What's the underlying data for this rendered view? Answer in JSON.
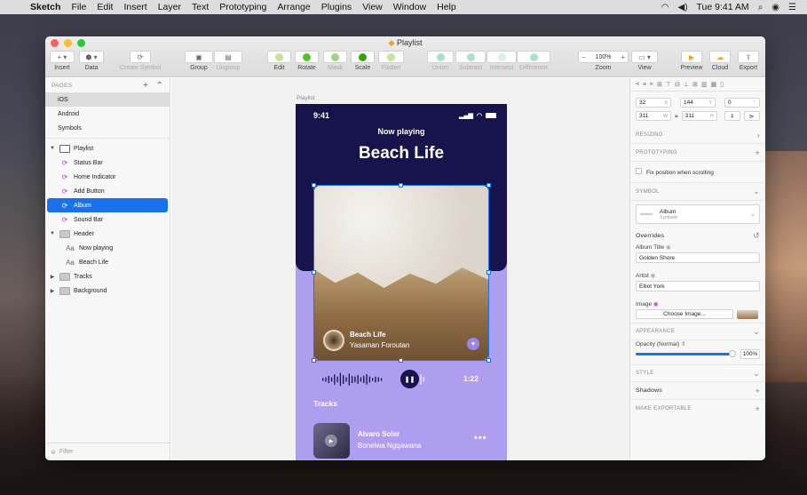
{
  "menubar": {
    "app": "Sketch",
    "items": [
      "File",
      "Edit",
      "Insert",
      "Layer",
      "Text",
      "Prototyping",
      "Arrange",
      "Plugins",
      "View",
      "Window",
      "Help"
    ],
    "clock": "Tue 9:41 AM"
  },
  "window": {
    "title": "Playlist"
  },
  "toolbar": {
    "insert": "Insert",
    "data": "Data",
    "create_symbol": "Create Symbol",
    "group": "Group",
    "ungroup": "Ungroup",
    "edit": "Edit",
    "rotate": "Rotate",
    "mask": "Mask",
    "scale": "Scale",
    "flatten": "Flatten",
    "union": "Union",
    "subtract": "Subtract",
    "intersect": "Intersect",
    "difference": "Difference",
    "zoom_label": "Zoom",
    "zoom_value": "100%",
    "view": "View",
    "preview": "Preview",
    "cloud": "Cloud",
    "export": "Export"
  },
  "layers": {
    "pages_header": "PAGES",
    "pages": [
      "iOS",
      "Android",
      "Symbols"
    ],
    "artboard": "Playlist",
    "items": [
      {
        "name": "Status Bar"
      },
      {
        "name": "Home Indicator"
      },
      {
        "name": "Add Button"
      },
      {
        "name": "Album"
      },
      {
        "name": "Sound Bar"
      }
    ],
    "header_group": "Header",
    "header_children": [
      "Now playing",
      "Beach Life"
    ],
    "tracks": "Tracks",
    "background": "Background",
    "filter_placeholder": "Filter"
  },
  "canvas": {
    "artboard_label": "Playlist",
    "time": "9:41",
    "now_playing": "Now playing",
    "song_title": "Beach Life",
    "album_title": "Beach Life",
    "album_artist": "Yasaman Foroutan",
    "duration": "1:22",
    "tracks_heading": "Tracks",
    "track_title": "Alvaro Soler",
    "track_artist": "Bonelwa Ngqawana"
  },
  "inspector": {
    "x": "32",
    "y": "144",
    "rotation": "0",
    "w": "311",
    "h": "311",
    "x_suffix": "X",
    "y_suffix": "Y",
    "w_suffix": "W",
    "h_suffix": "H",
    "resizing": "RESIZING",
    "prototyping": "PROTOTYPING",
    "fix_position": "Fix position when scrolling",
    "symbol": "SYMBOL",
    "symbol_name": "Album",
    "symbol_source": "Symbols/",
    "overrides": "Overrides",
    "album_title_label": "Album Title",
    "album_title_value": "Golden Shore",
    "artist_label": "Artist",
    "artist_value": "Elliot York",
    "image_label": "Image",
    "choose_image": "Choose Image...",
    "appearance": "APPEARANCE",
    "opacity_label": "Opacity (Normal)",
    "opacity_value": "100%",
    "opacity_fraction": 1.0,
    "style": "STYLE",
    "shadows": "Shadows",
    "make_exportable": "MAKE EXPORTABLE"
  }
}
